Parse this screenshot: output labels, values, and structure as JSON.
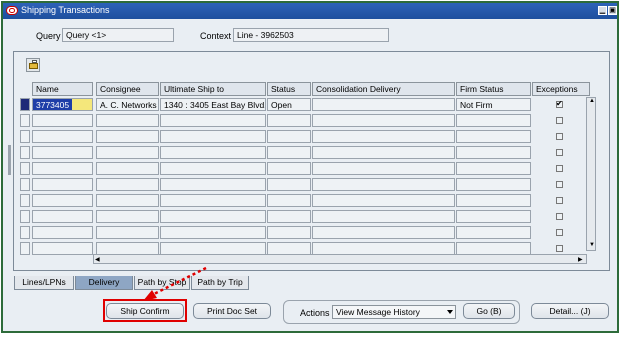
{
  "window": {
    "title": "Shipping Transactions"
  },
  "query": {
    "label": "Query",
    "value": "Query <1>"
  },
  "context": {
    "label": "Context",
    "value": "Line - 3962503"
  },
  "table": {
    "columns": [
      "Name",
      "Consignee",
      "Ultimate Ship to",
      "Status",
      "Consolidation Delivery",
      "Firm Status",
      "Exceptions"
    ],
    "rows": [
      {
        "name": "3773405",
        "consignee": "A. C. Networks",
        "ship_to": "1340 : 3405 East Bay Blvd.",
        "status": "Open",
        "consolidation": "",
        "firm_status": "Not Firm",
        "exceptions": true
      }
    ]
  },
  "tabs": [
    {
      "label": "Lines/LPNs",
      "active": false
    },
    {
      "label": "Delivery",
      "active": true
    },
    {
      "label": "Path by Stop",
      "active": false
    },
    {
      "label": "Path by Trip",
      "active": false
    }
  ],
  "buttons": {
    "ship_confirm": "Ship Confirm",
    "print_doc_set": "Print Doc Set",
    "actions_label": "Actions",
    "actions_value": "View Message History",
    "go": "Go (B)",
    "detail": "Detail... (J)"
  },
  "colors": {
    "highlight": "#e00000",
    "titlebar": "#2d62b8",
    "active_tab": "#8ea6c4"
  }
}
